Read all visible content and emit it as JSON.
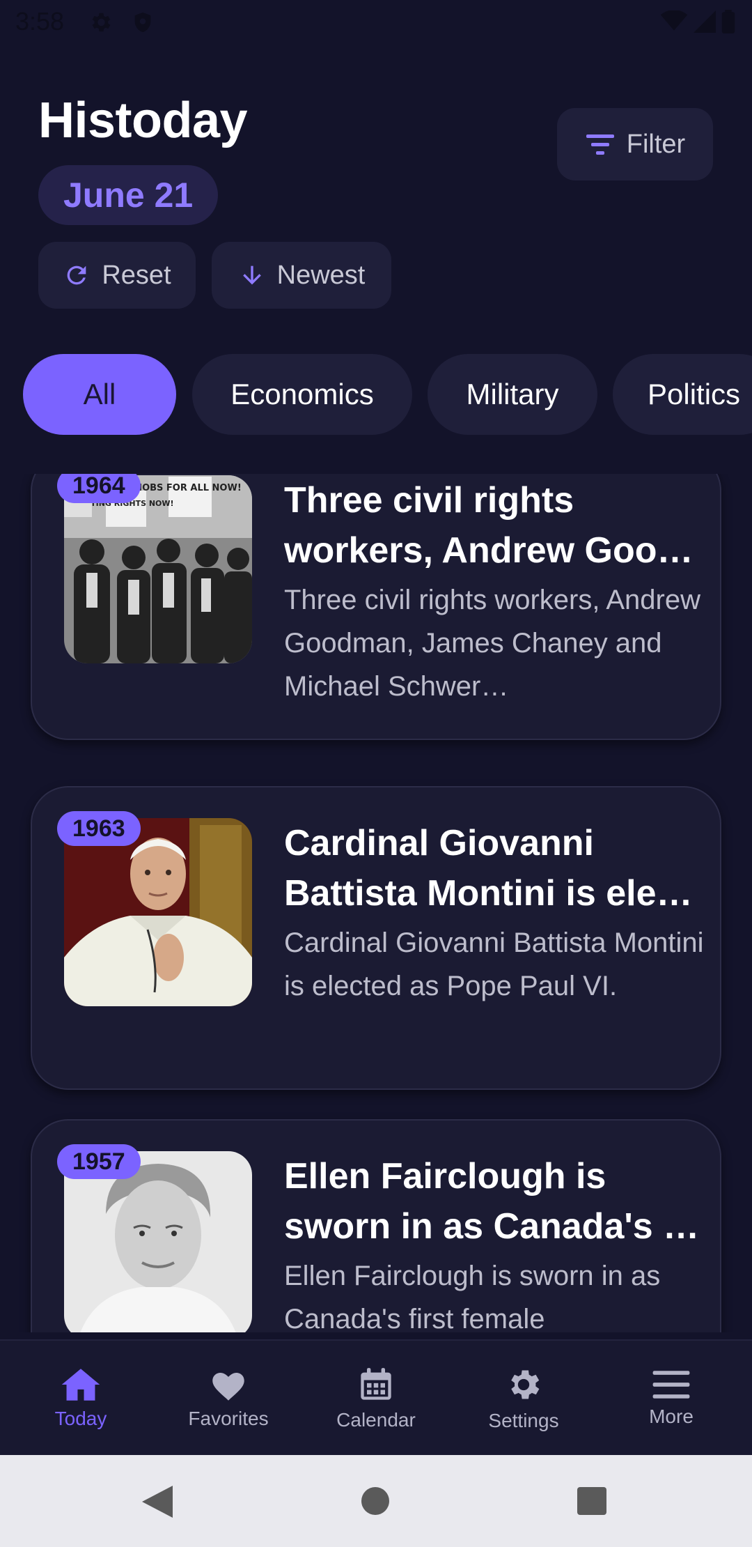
{
  "status_bar": {
    "time": "3:58"
  },
  "header": {
    "title": "Histoday",
    "date": "June 21",
    "filter_label": "Filter",
    "reset_label": "Reset",
    "sort_label": "Newest"
  },
  "tabs": [
    {
      "label": "All",
      "active": true
    },
    {
      "label": "Economics",
      "active": false
    },
    {
      "label": "Military",
      "active": false
    },
    {
      "label": "Politics",
      "active": false
    }
  ],
  "events": [
    {
      "year": "1964",
      "title": "Three civil rights workers, Andrew Goo…",
      "description": "Three civil rights workers, Andrew Goodman, James Chaney and Michael Schwer…",
      "sign_text_1": "JOBS FOR ALL NOW!",
      "sign_text_2": "VOTING RIGHTS NOW!"
    },
    {
      "year": "1963",
      "title": "Cardinal Giovanni Battista Montini is ele…",
      "description": "Cardinal Giovanni Battista Montini is elected as Pope Paul VI."
    },
    {
      "year": "1957",
      "title": "Ellen Fairclough is sworn in as Canada's …",
      "description": "Ellen Fairclough is sworn in as Canada's first female"
    }
  ],
  "bottom_nav": [
    {
      "label": "Today",
      "icon": "home-icon",
      "active": true
    },
    {
      "label": "Favorites",
      "icon": "heart-icon",
      "active": false
    },
    {
      "label": "Calendar",
      "icon": "calendar-icon",
      "active": false
    },
    {
      "label": "Settings",
      "icon": "gear-icon",
      "active": false
    },
    {
      "label": "More",
      "icon": "menu-icon",
      "active": false
    }
  ],
  "colors": {
    "accent": "#7b63ff",
    "background": "#13132a",
    "card": "#1b1b33"
  }
}
